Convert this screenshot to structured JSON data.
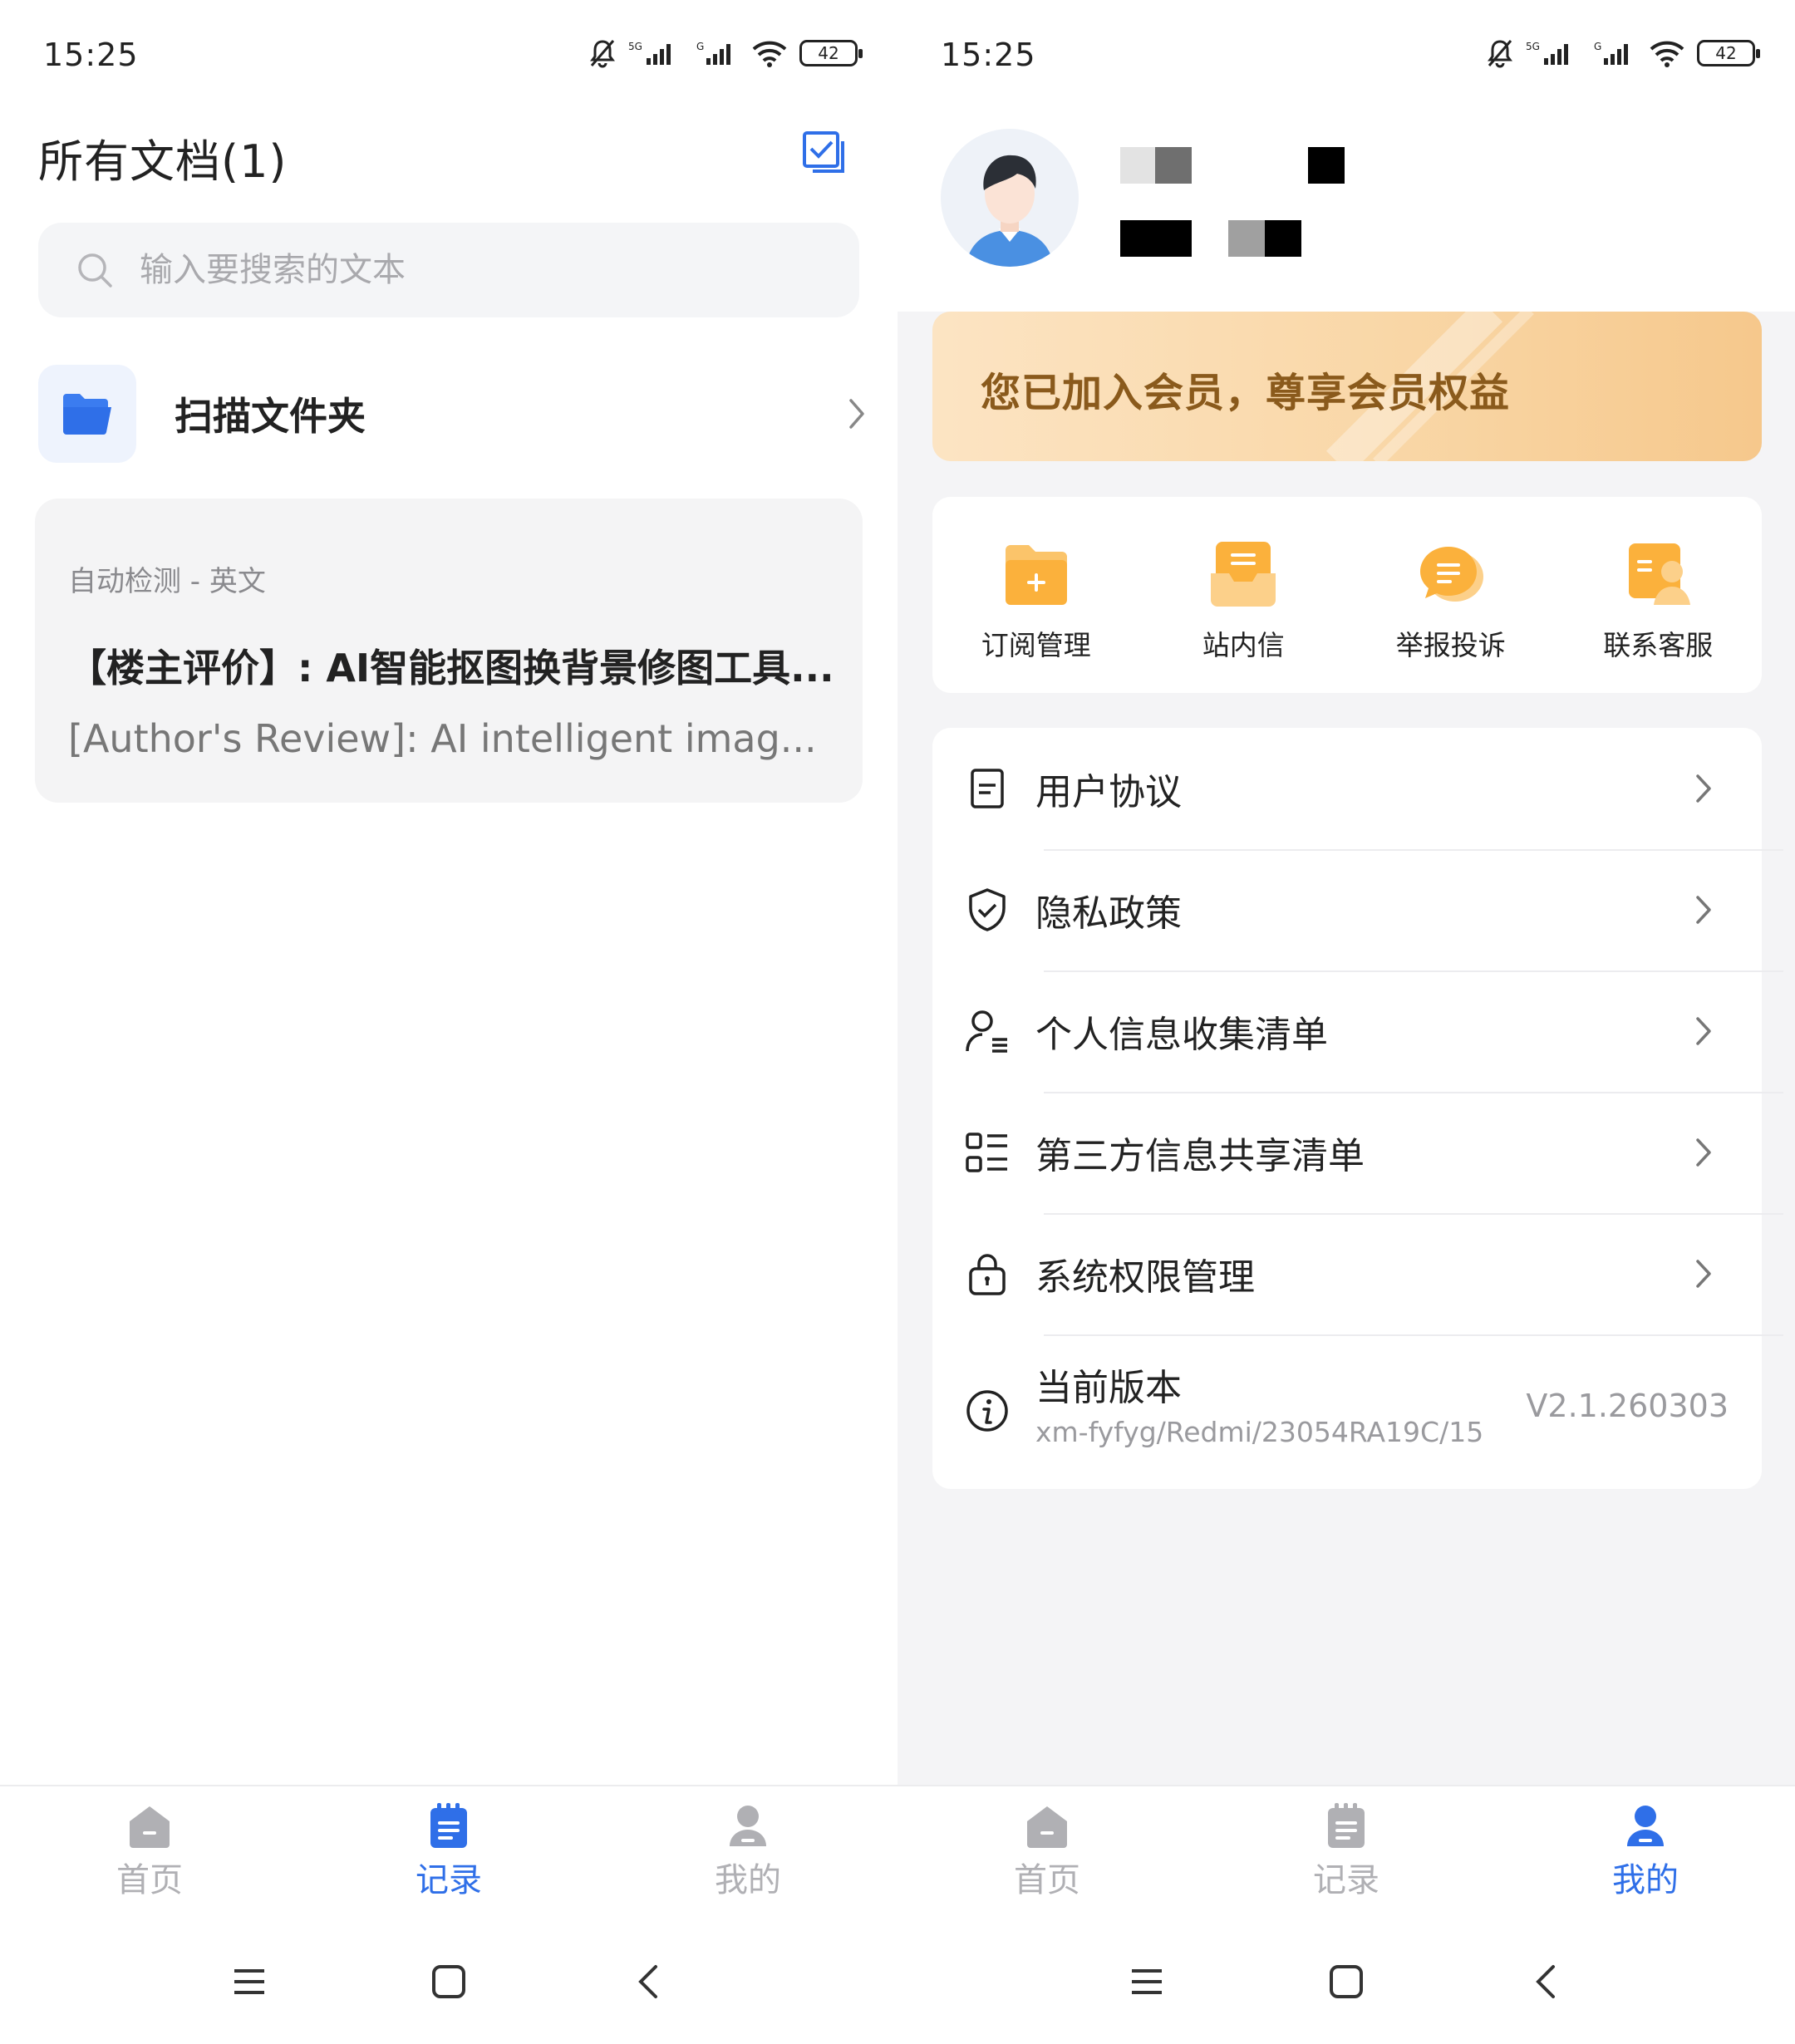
{
  "status": {
    "time": "15:25",
    "battery": "42",
    "network": "5G"
  },
  "left": {
    "title": "所有文档(1)",
    "search": {
      "placeholder": "输入要搜索的文本"
    },
    "folder": {
      "label": "扫描文件夹"
    },
    "doc": {
      "meta": "自动检测 - 英文",
      "title": "【楼主评价】: AI智能抠图换背景修图工具...",
      "preview": "[Author's Review]: AI intelligent imag..."
    }
  },
  "right": {
    "member_banner": "您已加入会员，尊享会员权益",
    "quick_actions": [
      {
        "label": "订阅管理",
        "icon": "subscription-folder-icon"
      },
      {
        "label": "站内信",
        "icon": "inbox-icon"
      },
      {
        "label": "举报投诉",
        "icon": "report-chat-icon"
      },
      {
        "label": "联系客服",
        "icon": "customer-service-icon"
      }
    ],
    "menu": [
      {
        "label": "用户协议",
        "icon": "document-icon"
      },
      {
        "label": "隐私政策",
        "icon": "shield-check-icon"
      },
      {
        "label": "个人信息收集清单",
        "icon": "user-list-icon"
      },
      {
        "label": "第三方信息共享清单",
        "icon": "list-icon"
      },
      {
        "label": "系统权限管理",
        "icon": "lock-icon"
      }
    ],
    "version": {
      "title": "当前版本",
      "subtitle": "xm-fyfyg/Redmi/23054RA19C/15",
      "value": "V2.1.260303"
    }
  },
  "nav": {
    "home": "首页",
    "records": "记录",
    "mine": "我的"
  },
  "colors": {
    "accent": "#2f6fe8",
    "inactive": "#b0b0b4",
    "banner_text": "#8a5a1c",
    "quick_icon": "#fbb13c"
  }
}
